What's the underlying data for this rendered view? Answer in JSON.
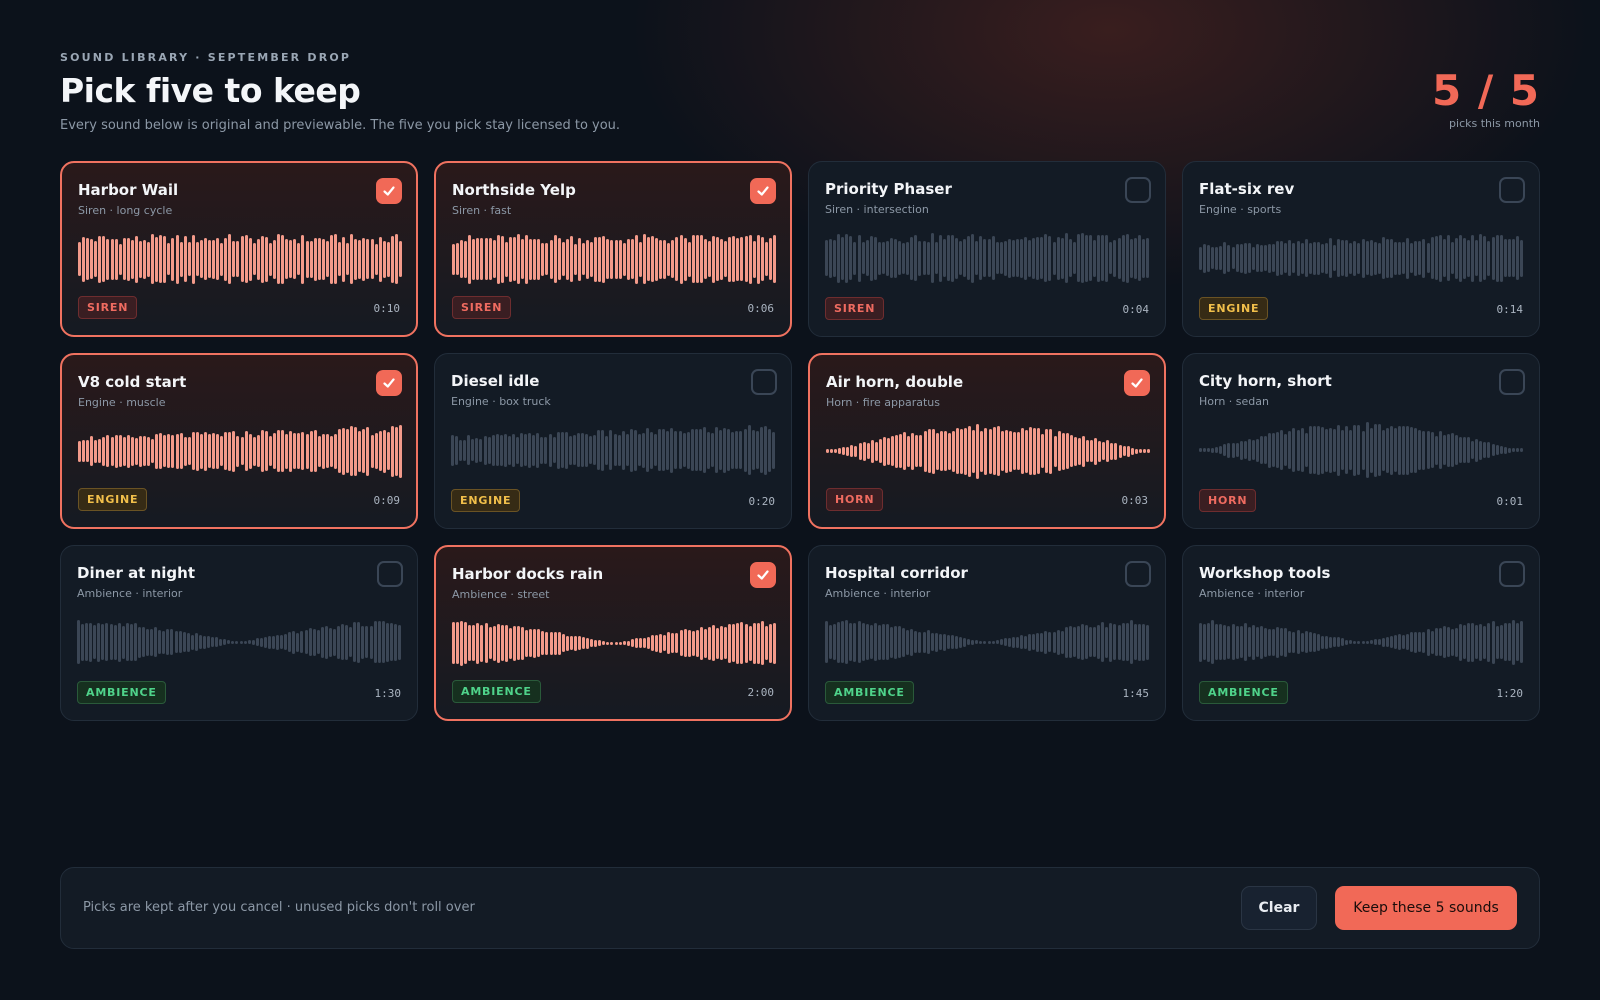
{
  "header": {
    "eyebrow": "SOUND LIBRARY · SEPTEMBER DROP",
    "title": "Pick five to keep",
    "subtitle": "Every sound below is original and previewable. The five you pick stay licensed to you.",
    "counter": "5 / 5",
    "counter_label": "picks this month"
  },
  "colors": {
    "accent": "#f16957",
    "siren_tag": "#ef6b60",
    "horn_tag": "#ef6b60",
    "engine_tag": "#f1bf4a",
    "ambience_tag": "#4fd38a"
  },
  "cards": [
    {
      "title": "Harbor Wail",
      "subtitle": "Siren · long cycle",
      "tag": "SIREN",
      "tag_kind": "siren",
      "duration": "0:10",
      "selected": true,
      "wave_shape": "steady"
    },
    {
      "title": "Northside Yelp",
      "subtitle": "Siren · fast",
      "tag": "SIREN",
      "tag_kind": "siren",
      "duration": "0:06",
      "selected": true,
      "wave_shape": "steady"
    },
    {
      "title": "Priority Phaser",
      "subtitle": "Siren · intersection",
      "tag": "SIREN",
      "tag_kind": "siren",
      "duration": "0:04",
      "selected": false,
      "wave_shape": "steady"
    },
    {
      "title": "Flat-six rev",
      "subtitle": "Engine · sports",
      "tag": "ENGINE",
      "tag_kind": "engine",
      "duration": "0:14",
      "selected": false,
      "wave_shape": "ramp"
    },
    {
      "title": "V8 cold start",
      "subtitle": "Engine · muscle",
      "tag": "ENGINE",
      "tag_kind": "engine",
      "duration": "0:09",
      "selected": true,
      "wave_shape": "ramp"
    },
    {
      "title": "Diesel idle",
      "subtitle": "Engine · box truck",
      "tag": "ENGINE",
      "tag_kind": "engine",
      "duration": "0:20",
      "selected": false,
      "wave_shape": "ramp"
    },
    {
      "title": "Air horn, double",
      "subtitle": "Horn · fire apparatus",
      "tag": "HORN",
      "tag_kind": "horn",
      "duration": "0:03",
      "selected": true,
      "wave_shape": "burst"
    },
    {
      "title": "City horn, short",
      "subtitle": "Horn · sedan",
      "tag": "HORN",
      "tag_kind": "horn",
      "duration": "0:01",
      "selected": false,
      "wave_shape": "burst"
    },
    {
      "title": "Diner at night",
      "subtitle": "Ambience · interior",
      "tag": "AMBIENCE",
      "tag_kind": "ambience",
      "duration": "1:30",
      "selected": false,
      "wave_shape": "valley"
    },
    {
      "title": "Harbor docks rain",
      "subtitle": "Ambience · street",
      "tag": "AMBIENCE",
      "tag_kind": "ambience",
      "duration": "2:00",
      "selected": true,
      "wave_shape": "valley"
    },
    {
      "title": "Hospital corridor",
      "subtitle": "Ambience · interior",
      "tag": "AMBIENCE",
      "tag_kind": "ambience",
      "duration": "1:45",
      "selected": false,
      "wave_shape": "valley"
    },
    {
      "title": "Workshop tools",
      "subtitle": "Ambience · interior",
      "tag": "AMBIENCE",
      "tag_kind": "ambience",
      "duration": "1:20",
      "selected": false,
      "wave_shape": "valley"
    }
  ],
  "footer": {
    "note": "Picks are kept after you cancel · unused picks don't roll over",
    "clear_label": "Clear",
    "keep_label": "Keep these 5 sounds"
  }
}
